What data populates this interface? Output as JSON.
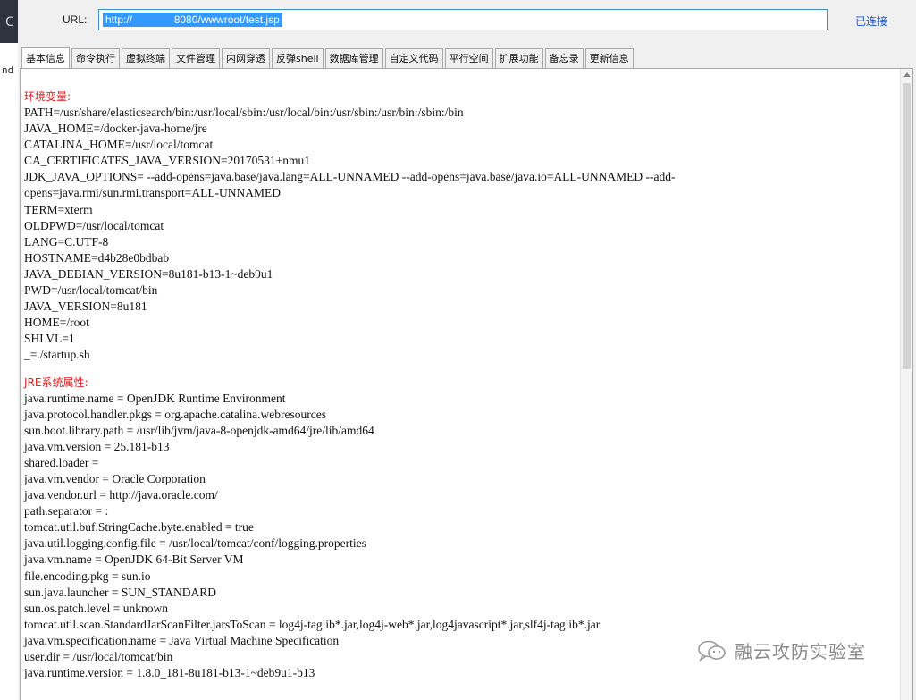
{
  "left_strip": {
    "top_glyph": "C",
    "stray_text": "nd"
  },
  "url_bar": {
    "label": "URL:",
    "value": "http://              8080/wwwroot/test.jsp",
    "status": "已连接"
  },
  "tabs": [
    {
      "label": "基本信息",
      "active": true
    },
    {
      "label": "命令执行"
    },
    {
      "label": "虚拟终端"
    },
    {
      "label": "文件管理"
    },
    {
      "label": "内网穿透"
    },
    {
      "label": "反弹shell"
    },
    {
      "label": "数据库管理"
    },
    {
      "label": "自定义代码"
    },
    {
      "label": "平行空间"
    },
    {
      "label": "扩展功能"
    },
    {
      "label": "备忘录"
    },
    {
      "label": "更新信息"
    }
  ],
  "env_section": {
    "heading": "环境变量:",
    "lines": [
      "PATH=/usr/share/elasticsearch/bin:/usr/local/sbin:/usr/local/bin:/usr/sbin:/usr/bin:/sbin:/bin",
      "JAVA_HOME=/docker-java-home/jre",
      "CATALINA_HOME=/usr/local/tomcat",
      "CA_CERTIFICATES_JAVA_VERSION=20170531+nmu1",
      "JDK_JAVA_OPTIONS= --add-opens=java.base/java.lang=ALL-UNNAMED --add-opens=java.base/java.io=ALL-UNNAMED --add-opens=java.rmi/sun.rmi.transport=ALL-UNNAMED",
      "TERM=xterm",
      "OLDPWD=/usr/local/tomcat",
      "LANG=C.UTF-8",
      "HOSTNAME=d4b28e0bdbab",
      "JAVA_DEBIAN_VERSION=8u181-b13-1~deb9u1",
      "PWD=/usr/local/tomcat/bin",
      "JAVA_VERSION=8u181",
      "HOME=/root",
      "SHLVL=1",
      "_=./startup.sh"
    ]
  },
  "jre_section": {
    "heading": "JRE系统属性:",
    "lines": [
      "java.runtime.name = OpenJDK Runtime Environment",
      "java.protocol.handler.pkgs = org.apache.catalina.webresources",
      "sun.boot.library.path = /usr/lib/jvm/java-8-openjdk-amd64/jre/lib/amd64",
      "java.vm.version = 25.181-b13",
      "shared.loader =",
      "java.vm.vendor = Oracle Corporation",
      "java.vendor.url = http://java.oracle.com/",
      "path.separator = :",
      "tomcat.util.buf.StringCache.byte.enabled = true",
      "java.util.logging.config.file = /usr/local/tomcat/conf/logging.properties",
      "java.vm.name = OpenJDK 64-Bit Server VM",
      "file.encoding.pkg = sun.io",
      "sun.java.launcher = SUN_STANDARD",
      "sun.os.patch.level = unknown",
      "tomcat.util.scan.StandardJarScanFilter.jarsToScan = log4j-taglib*.jar,log4j-web*.jar,log4javascript*.jar,slf4j-taglib*.jar",
      "java.vm.specification.name = Java Virtual Machine Specification",
      "user.dir = /usr/local/tomcat/bin",
      "java.runtime.version = 1.8.0_181-8u181-b13-1~deb9u1-b13"
    ]
  },
  "watermark": {
    "text": "融云攻防实验室",
    "icon": "wechat-icon"
  }
}
